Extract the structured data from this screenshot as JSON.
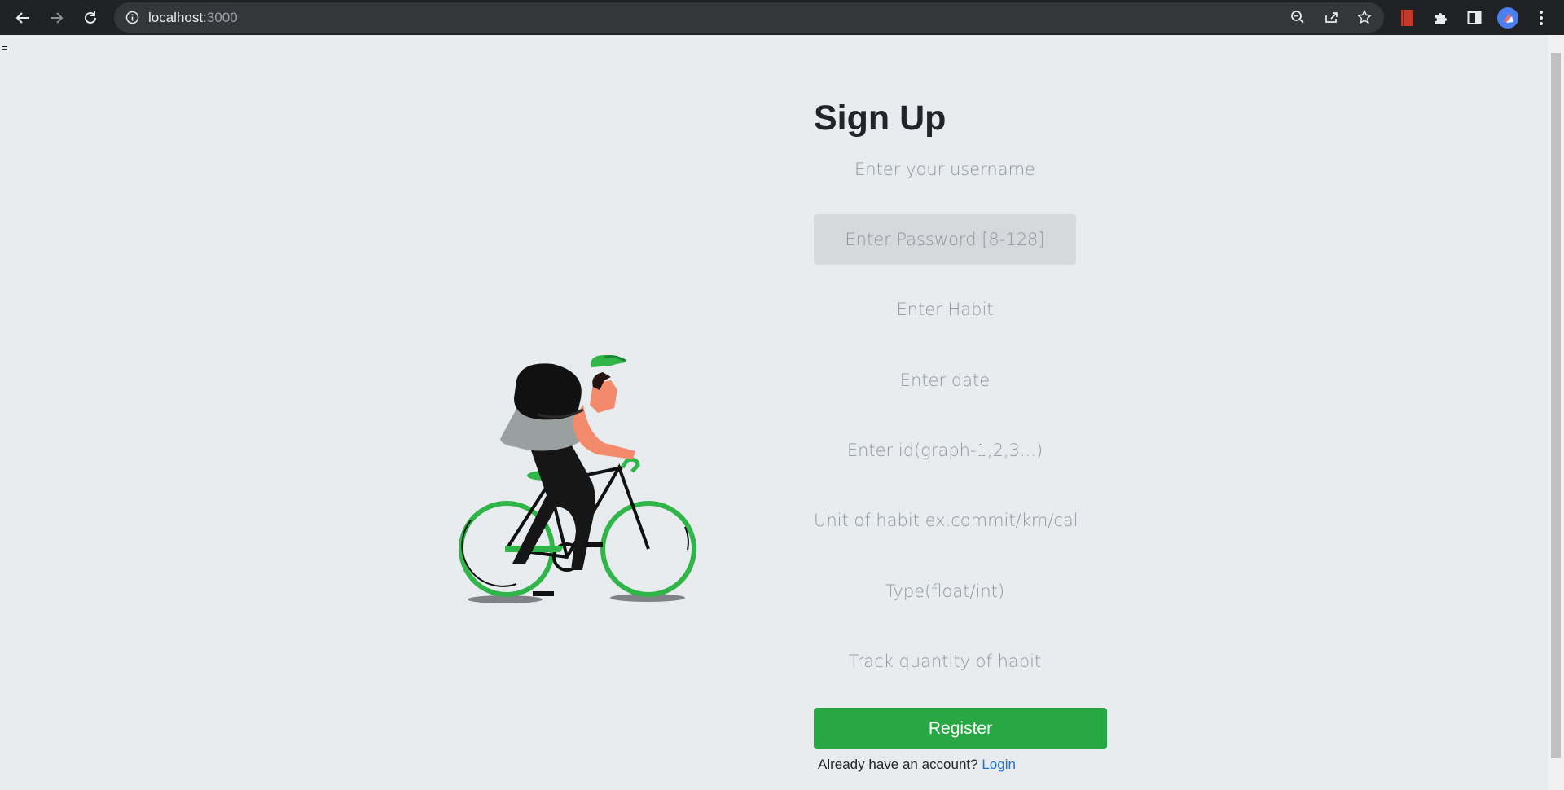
{
  "browser": {
    "url_host": "localhost",
    "url_port": ":3000"
  },
  "page": {
    "stray_text": "=",
    "title": "Sign Up"
  },
  "form": {
    "username_placeholder": "Enter your username",
    "password_placeholder": "Enter Password [8-128]",
    "habit_placeholder": "Enter Habit",
    "date_placeholder": "Enter date",
    "id_placeholder": "Enter id(graph-1,2,3...)",
    "unit_placeholder": "Unit of habit ex.commit/km/calory",
    "type_placeholder": "Type(float/int)",
    "quantity_placeholder": "Track quantity of habit",
    "register_label": "Register"
  },
  "footer": {
    "prompt": "Already have an account?",
    "login_label": "Login"
  },
  "colors": {
    "accent": "#28a745",
    "link": "#1a73d9",
    "background": "#e9ecef"
  }
}
